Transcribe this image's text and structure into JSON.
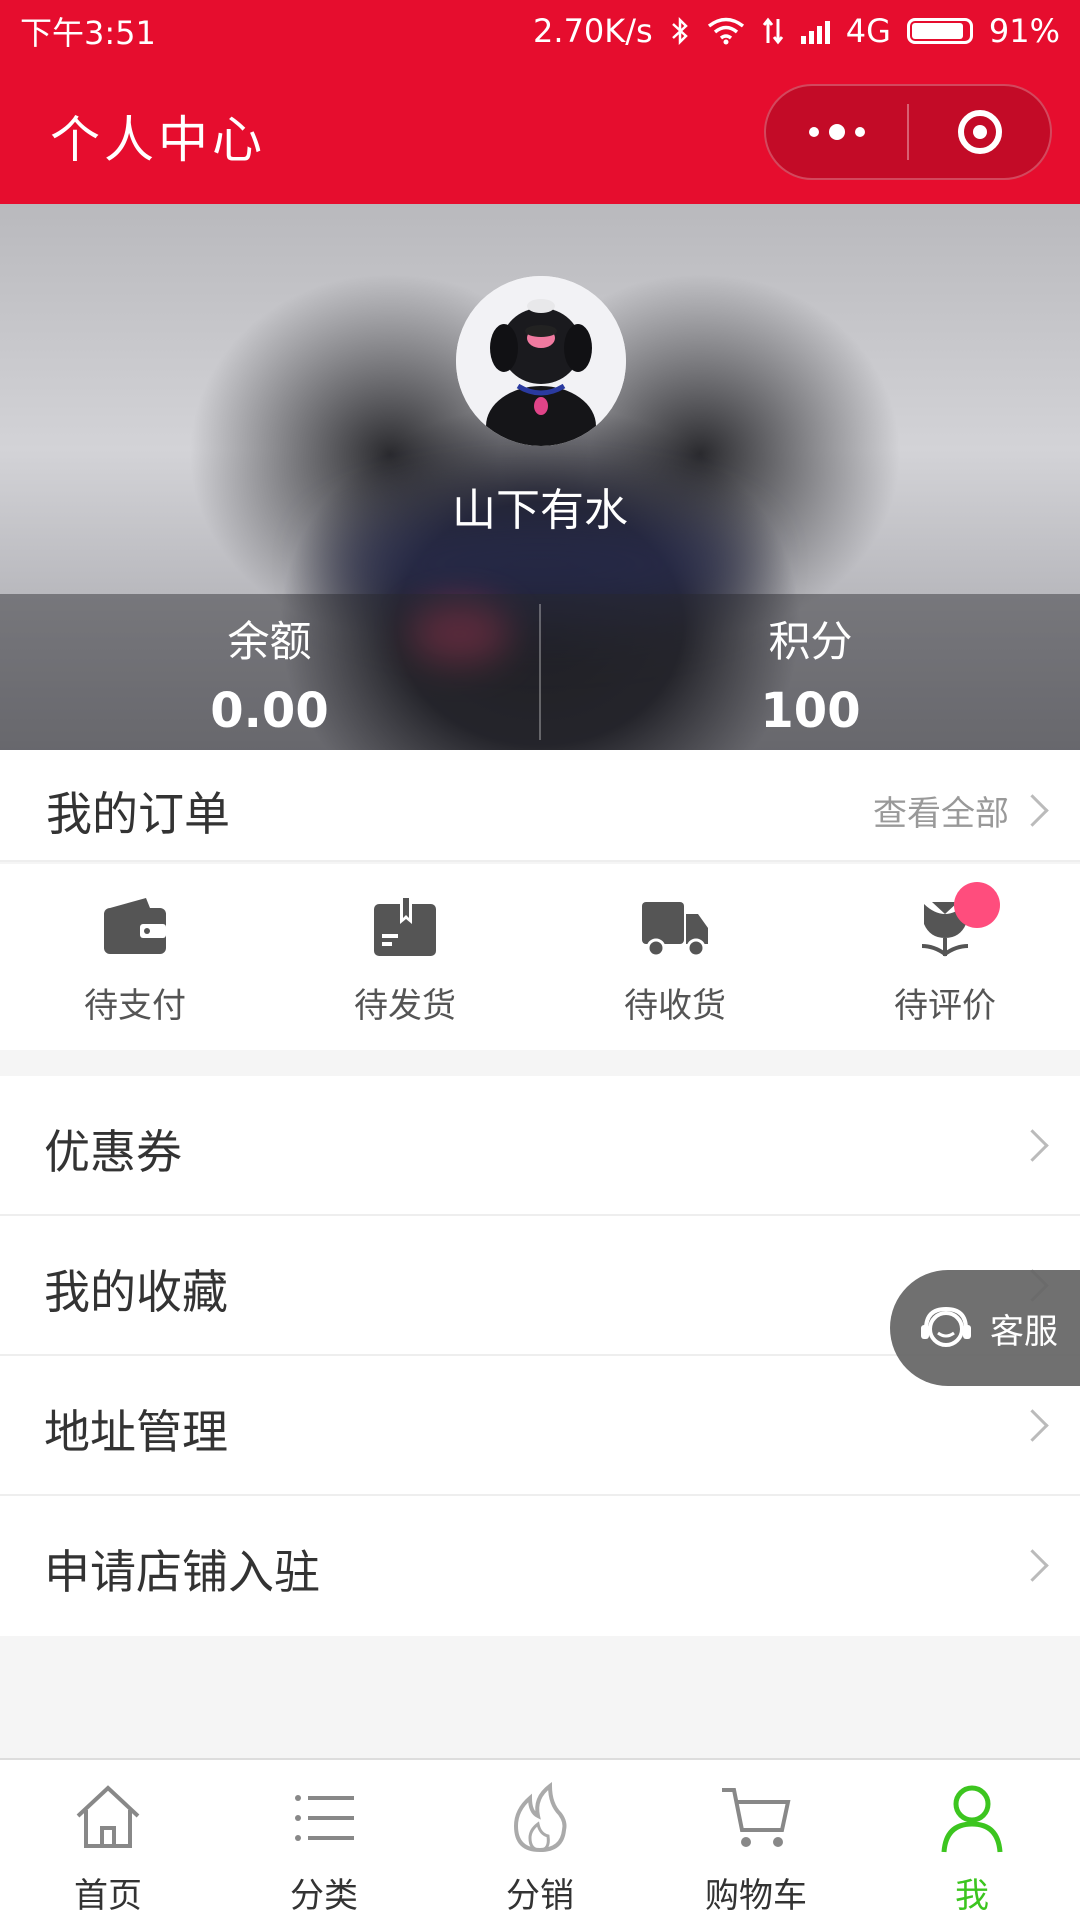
{
  "status_bar": {
    "time": "下午3:51",
    "net_speed": "2.70K/s",
    "network": "4G",
    "battery": "91%",
    "battery_level": 0.91
  },
  "header": {
    "title": "个人中心",
    "more_icon": "more-dots-icon",
    "close_icon": "target-icon",
    "color": "#e60d2e"
  },
  "profile": {
    "nickname": "山下有水",
    "stats": [
      {
        "label": "余额",
        "value": "0.00"
      },
      {
        "label": "积分",
        "value": "100"
      }
    ]
  },
  "orders": {
    "title": "我的订单",
    "view_all": "查看全部",
    "items": [
      {
        "label": "待支付",
        "icon": "wallet-icon"
      },
      {
        "label": "待发货",
        "icon": "package-icon"
      },
      {
        "label": "待收货",
        "icon": "truck-icon"
      },
      {
        "label": "待评价",
        "icon": "flower-icon",
        "badge": true
      }
    ]
  },
  "menu": [
    {
      "label": "优惠券"
    },
    {
      "label": "我的收藏"
    },
    {
      "label": "地址管理"
    },
    {
      "label": "申请店铺入驻"
    }
  ],
  "service": {
    "label": "客服",
    "icon": "headset-icon"
  },
  "tabbar": {
    "active_color": "#3cc51f",
    "items": [
      {
        "label": "首页",
        "icon": "home-icon"
      },
      {
        "label": "分类",
        "icon": "list-icon"
      },
      {
        "label": "分销",
        "icon": "fire-icon"
      },
      {
        "label": "购物车",
        "icon": "cart-icon"
      },
      {
        "label": "我",
        "icon": "user-icon"
      }
    ]
  }
}
